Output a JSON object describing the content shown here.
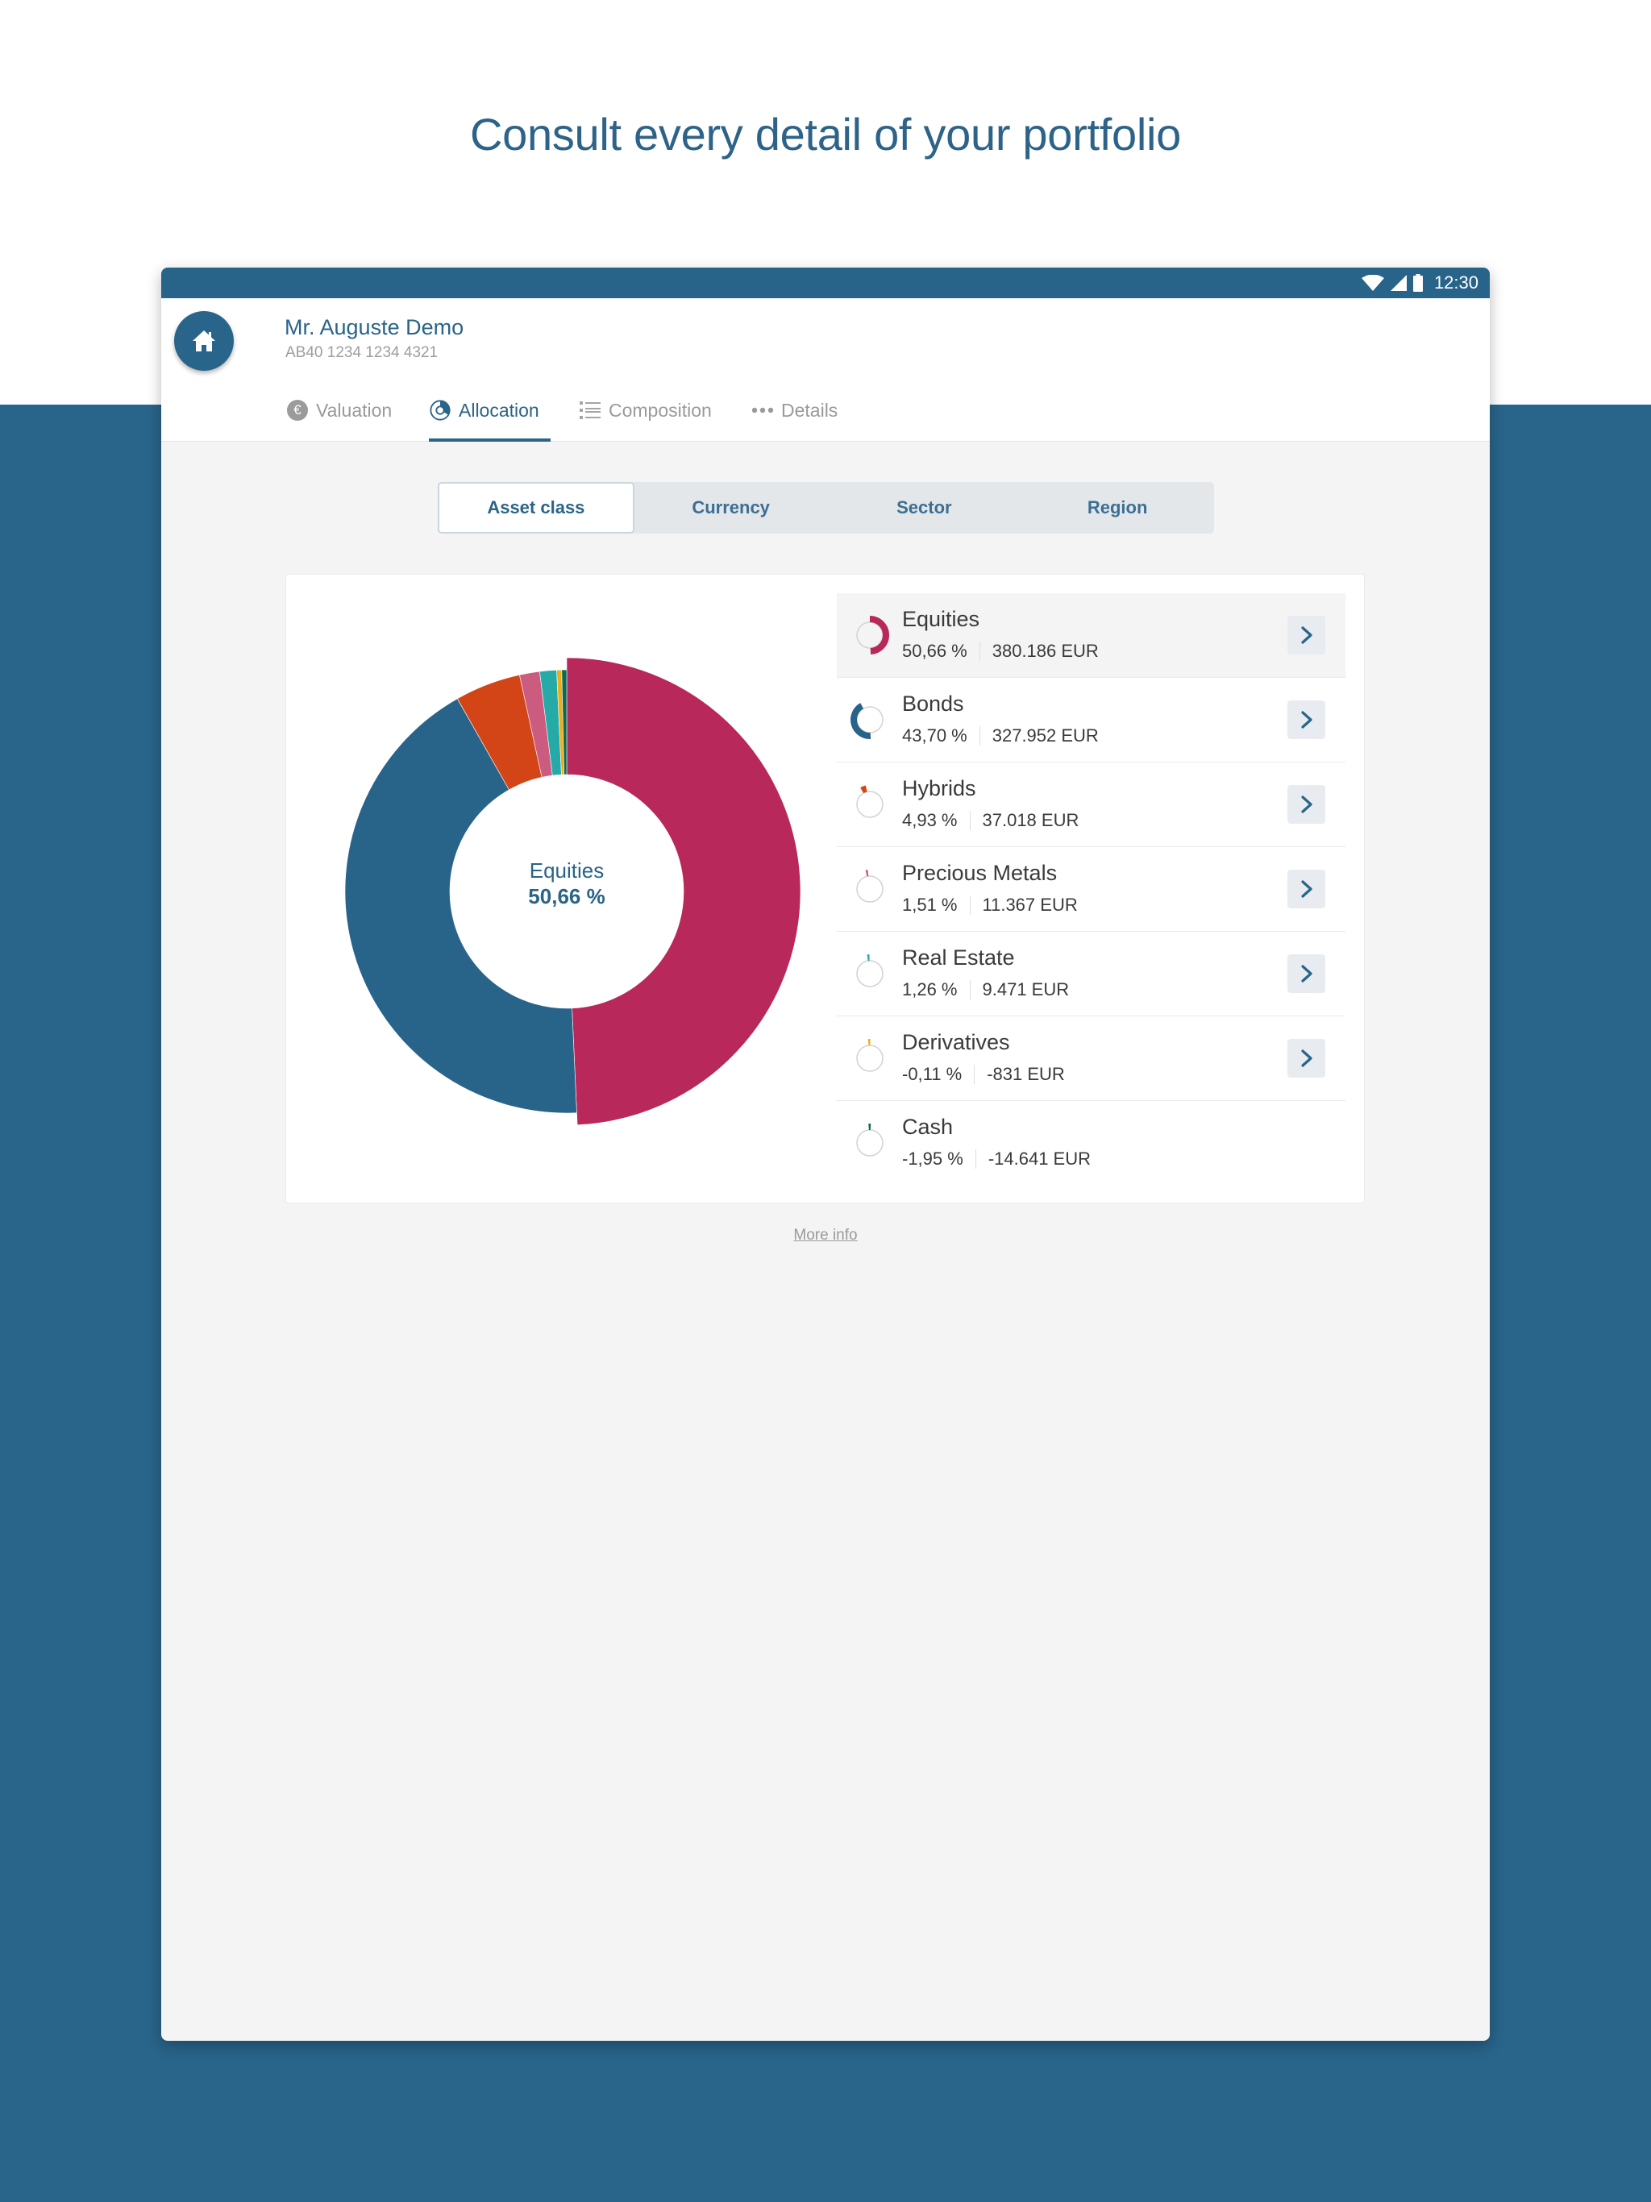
{
  "page": {
    "headline": "Consult every detail of your portfolio"
  },
  "status_bar": {
    "time": "12:30",
    "icons": [
      "wifi-icon",
      "signal-icon",
      "battery-icon"
    ]
  },
  "header": {
    "home_icon": "home-icon",
    "client_name": "Mr. Auguste Demo",
    "account_number": "AB40 1234 1234 4321"
  },
  "tabs": [
    {
      "label": "Valuation",
      "icon": "euro-icon",
      "active": false
    },
    {
      "label": "Allocation",
      "icon": "pie-chart-icon",
      "active": true
    },
    {
      "label": "Composition",
      "icon": "list-icon",
      "active": false
    },
    {
      "label": "Details",
      "icon": "more-dots-icon",
      "active": false
    }
  ],
  "segments": [
    {
      "label": "Asset class",
      "active": true
    },
    {
      "label": "Currency",
      "active": false
    },
    {
      "label": "Sector",
      "active": false
    },
    {
      "label": "Region",
      "active": false
    }
  ],
  "allocation": {
    "center_label": "Equities",
    "center_value": "50,66 %",
    "items": [
      {
        "name": "Equities",
        "percent": "50,66 %",
        "amount": "380.186 EUR",
        "has_detail": true,
        "selected": true
      },
      {
        "name": "Bonds",
        "percent": "43,70 %",
        "amount": "327.952 EUR",
        "has_detail": true,
        "selected": false
      },
      {
        "name": "Hybrids",
        "percent": "4,93 %",
        "amount": "37.018 EUR",
        "has_detail": true,
        "selected": false
      },
      {
        "name": "Precious Metals",
        "percent": "1,51 %",
        "amount": "11.367 EUR",
        "has_detail": true,
        "selected": false
      },
      {
        "name": "Real Estate",
        "percent": "1,26 %",
        "amount": "9.471 EUR",
        "has_detail": true,
        "selected": false
      },
      {
        "name": "Derivatives",
        "percent": "-0,11 %",
        "amount": "-831 EUR",
        "has_detail": true,
        "selected": false
      },
      {
        "name": "Cash",
        "percent": "-1,95 %",
        "amount": "-14.641 EUR",
        "has_detail": false,
        "selected": false
      }
    ]
  },
  "more_info_label": "More info",
  "colors": {
    "brand": "#29648a",
    "text_primary": "#3a3a3a",
    "text_muted": "#9a9a9a",
    "content_bg": "#f4f4f4"
  },
  "chart_data": {
    "type": "pie",
    "variant": "donut",
    "title": "",
    "categories": [
      "Equities",
      "Bonds",
      "Hybrids",
      "Precious Metals",
      "Real Estate",
      "Derivatives",
      "Cash"
    ],
    "values": [
      50.66,
      43.7,
      4.93,
      1.51,
      1.26,
      -0.11,
      -1.95
    ],
    "amounts_eur": [
      380186,
      327952,
      37018,
      11367,
      9471,
      -831,
      -14641
    ],
    "colors": [
      "#b8285a",
      "#28638a",
      "#d34516",
      "#cc5b80",
      "#26aaa8",
      "#efae17",
      "#0b6b52"
    ],
    "highlighted": "Equities",
    "start": "top",
    "direction": "clockwise",
    "legend": "right"
  }
}
